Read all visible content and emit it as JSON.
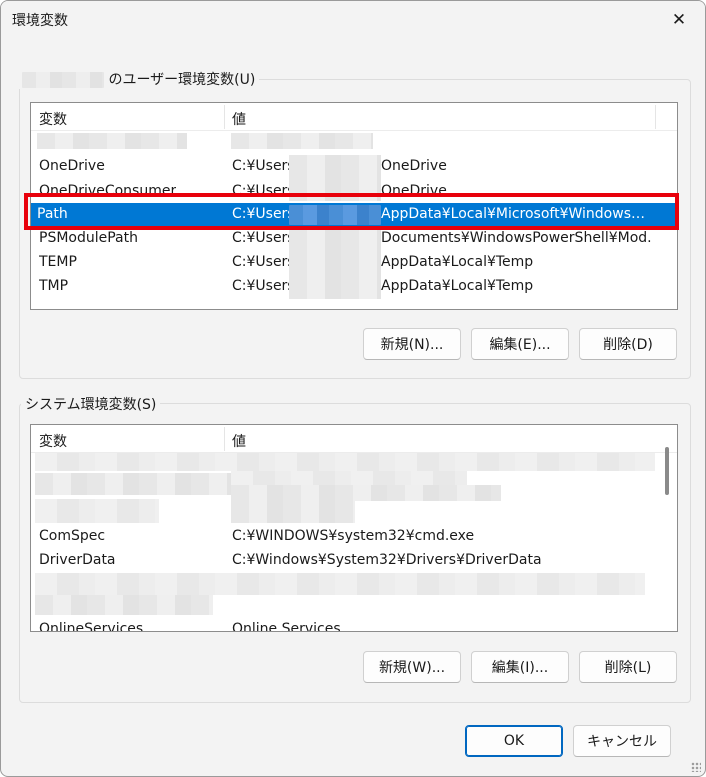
{
  "window": {
    "title": "環境変数",
    "close_glyph": "✕"
  },
  "user_group": {
    "label_suffix": "のユーザー環境変数(U)",
    "columns": {
      "name": "変数",
      "value": "値"
    },
    "rows": [
      {
        "name": "",
        "value_prefix": "",
        "value_suffix": ""
      },
      {
        "name": "OneDrive",
        "value_prefix": "C:¥Users",
        "value_suffix": "OneDrive"
      },
      {
        "name": "OneDriveConsumer",
        "value_prefix": "C:¥Users",
        "value_suffix": "OneDrive"
      },
      {
        "name": "Path",
        "value_prefix": "C:¥Users",
        "value_suffix": "AppData¥Local¥Microsoft¥WindowsA..."
      },
      {
        "name": "PSModulePath",
        "value_prefix": "C:¥Users",
        "value_suffix": "Documents¥WindowsPowerShell¥Mod..."
      },
      {
        "name": "TEMP",
        "value_prefix": "C:¥Users",
        "value_suffix": "AppData¥Local¥Temp"
      },
      {
        "name": "TMP",
        "value_prefix": "C:¥Users",
        "value_suffix": "AppData¥Local¥Temp"
      }
    ],
    "buttons": {
      "new": "新規(N)...",
      "edit": "編集(E)...",
      "delete": "削除(D)"
    }
  },
  "system_group": {
    "label": "システム環境変数(S)",
    "columns": {
      "name": "変数",
      "value": "値"
    },
    "rows": [
      {
        "name": "ComSpec",
        "value": "C:¥WINDOWS¥system32¥cmd.exe"
      },
      {
        "name": "DriverData",
        "value": "C:¥Windows¥System32¥Drivers¥DriverData"
      },
      {
        "name": "OnlineServices",
        "value": "Online Services"
      }
    ],
    "buttons": {
      "new": "新規(W)...",
      "edit": "編集(I)...",
      "delete": "削除(L)"
    }
  },
  "footer": {
    "ok": "OK",
    "cancel": "キャンセル"
  },
  "colors": {
    "selection": "#0078d4",
    "annotation": "#e8000b",
    "primary_border": "#0067c0"
  }
}
